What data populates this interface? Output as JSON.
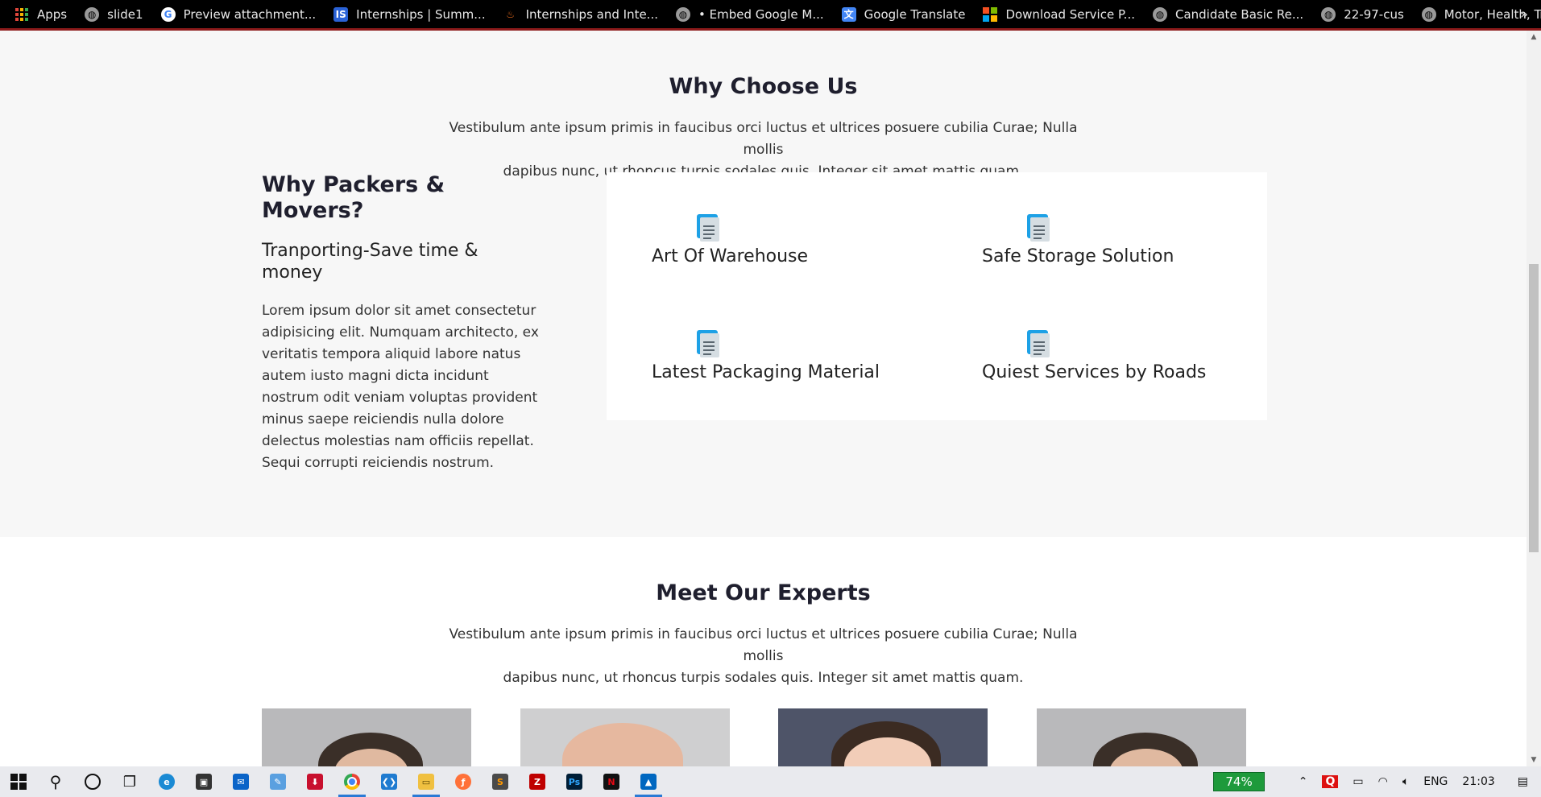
{
  "bookmarks": [
    {
      "label": "Apps",
      "icon": "apps-grid-icon"
    },
    {
      "label": "slide1",
      "icon": "globe-icon"
    },
    {
      "label": "Preview attachment...",
      "icon": "google-icon"
    },
    {
      "label": "Internships | Summ...",
      "icon": "internshala-icon"
    },
    {
      "label": "Internships and Inte...",
      "icon": "flame-icon"
    },
    {
      "label": "• Embed Google M...",
      "icon": "globe-icon"
    },
    {
      "label": "Google Translate",
      "icon": "google-translate-icon"
    },
    {
      "label": "Download Service P...",
      "icon": "microsoft-icon"
    },
    {
      "label": "Candidate Basic Re...",
      "icon": "globe-icon"
    },
    {
      "label": "22-97-cus",
      "icon": "globe-icon"
    },
    {
      "label": "Motor, Health, Trav...",
      "icon": "globe-icon"
    }
  ],
  "bookmarks_more": "»",
  "why_choose": {
    "title": "Why Choose Us",
    "subtitle_line1": "Vestibulum ante ipsum primis in faucibus orci luctus et ultrices posuere cubilia Curae; Nulla mollis",
    "subtitle_line2": "dapibus nunc, ut rhoncus turpis sodales quis. Integer sit amet mattis quam.",
    "left": {
      "heading_line1": "Why Packers &",
      "heading_line2": "Movers?",
      "subheading_line1": "Tranporting-Save time &",
      "subheading_line2": "money",
      "body": "Lorem ipsum dolor sit amet consectetur adipisicing elit. Numquam architecto, ex veritatis tempora aliquid labore natus autem iusto magni dicta incidunt nostrum odit veniam voluptas provident minus saepe reiciendis nulla dolore delectus molestias nam officiis repellat. Sequi corrupti reiciendis nostrum."
    },
    "features": [
      {
        "title": "Art Of Warehouse",
        "icon": "document-icon"
      },
      {
        "title": "Safe Storage Solution",
        "icon": "document-icon"
      },
      {
        "title": "Latest Packaging Material",
        "icon": "document-icon"
      },
      {
        "title": "Quiest Services by Roads",
        "icon": "document-icon"
      }
    ]
  },
  "experts": {
    "title": "Meet Our Experts",
    "subtitle_line1": "Vestibulum ante ipsum primis in faucibus orci luctus et ultrices posuere cubilia Curae; Nulla mollis",
    "subtitle_line2": "dapibus nunc, ut rhoncus turpis sodales quis. Integer sit amet mattis quam."
  },
  "taskbar": {
    "apps": [
      "start-icon",
      "search-icon",
      "cortana-icon",
      "task-view-icon",
      "edge-icon",
      "store-icon",
      "mail-icon",
      "pen-icon",
      "download-icon",
      "chrome-icon",
      "vscode-icon",
      "file-explorer-icon",
      "firefox-icon",
      "sublime-icon",
      "filezilla-icon",
      "photoshop-icon",
      "netflix-icon",
      "photos-icon"
    ],
    "active_app": "chrome-icon",
    "battery_label": "74%",
    "language": "ENG",
    "time": "21:03"
  },
  "colors": {
    "accent_blue": "#1da1e6",
    "bookmark_bar": "#000000",
    "battery_green": "#1e9a3b"
  }
}
